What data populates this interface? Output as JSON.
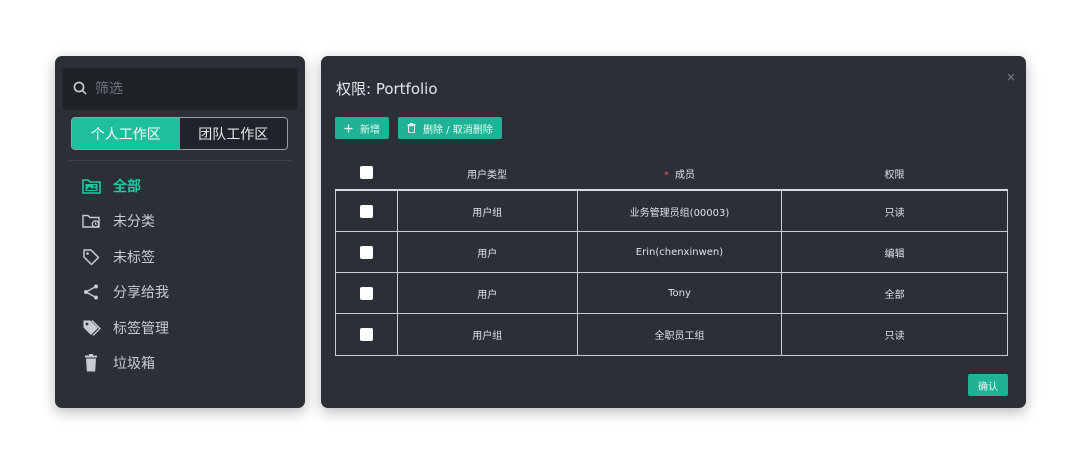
{
  "sidebar": {
    "filter_placeholder": "筛选",
    "workspace_tabs": [
      {
        "label": "个人工作区",
        "active": true
      },
      {
        "label": "团队工作区",
        "active": false
      }
    ],
    "nav_items": [
      {
        "label": "全部",
        "icon": "image-folder-icon",
        "active": true
      },
      {
        "label": "未分类",
        "icon": "folder-clock-icon",
        "active": false
      },
      {
        "label": "未标签",
        "icon": "tag-outline-icon",
        "active": false
      },
      {
        "label": "分享给我",
        "icon": "share-icon",
        "active": false
      },
      {
        "label": "标签管理",
        "icon": "tags-icon",
        "active": false
      },
      {
        "label": "垃圾箱",
        "icon": "trash-icon",
        "active": false
      }
    ]
  },
  "dialog": {
    "title": "权限: Portfolio",
    "close_label": "×",
    "add_button": "新增",
    "delete_button": "删除 / 取消删除",
    "confirm_button": "确认",
    "columns": [
      "用户类型",
      "成员",
      "权限"
    ],
    "required_mark": "*",
    "rows": [
      {
        "type": "用户组",
        "member": "业务管理员组(00003)",
        "permission": "只读"
      },
      {
        "type": "用户",
        "member": "Erin(chenxinwen)",
        "permission": "编辑"
      },
      {
        "type": "用户",
        "member": "Tony",
        "permission": "全部"
      },
      {
        "type": "用户组",
        "member": "全职员工组",
        "permission": "只读"
      }
    ]
  },
  "colors": {
    "accent": "#1fbf9e",
    "panel_bg": "#2b2f36",
    "required": "#e25a5a"
  }
}
